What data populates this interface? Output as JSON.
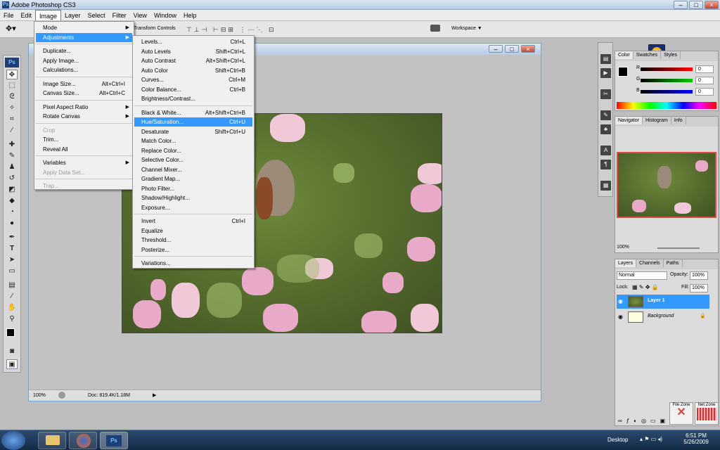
{
  "app": {
    "title": "Adobe Photoshop CS3",
    "logo": "Ps"
  },
  "menubar": [
    "File",
    "Edit",
    "Image",
    "Layer",
    "Select",
    "Filter",
    "View",
    "Window",
    "Help"
  ],
  "options": {
    "transform_controls": "Transform Controls",
    "workspace": "Workspace ▼"
  },
  "image_menu": [
    {
      "label": "Mode",
      "shortcut": "",
      "arrow": "▶"
    },
    {
      "label": "Adjustments",
      "shortcut": "",
      "arrow": "▶",
      "hl": true
    },
    {
      "label": "Duplicate...",
      "shortcut": ""
    },
    {
      "label": "Apply Image...",
      "shortcut": ""
    },
    {
      "label": "Calculations...",
      "shortcut": ""
    },
    {
      "label": "Image Size...",
      "shortcut": "Alt+Ctrl+I"
    },
    {
      "label": "Canvas Size...",
      "shortcut": "Alt+Ctrl+C"
    },
    {
      "label": "Pixel Aspect Ratio",
      "shortcut": "",
      "arrow": "▶"
    },
    {
      "label": "Rotate Canvas",
      "shortcut": "",
      "arrow": "▶"
    },
    {
      "label": "Crop",
      "shortcut": "",
      "dis": true
    },
    {
      "label": "Trim...",
      "shortcut": ""
    },
    {
      "label": "Reveal All",
      "shortcut": ""
    },
    {
      "label": "Variables",
      "shortcut": "",
      "arrow": "▶"
    },
    {
      "label": "Apply Data Set...",
      "shortcut": "",
      "dis": true
    },
    {
      "label": "Trap...",
      "shortcut": "",
      "dis": true
    }
  ],
  "adjust_menu": [
    {
      "label": "Levels...",
      "shortcut": "Ctrl+L"
    },
    {
      "label": "Auto Levels",
      "shortcut": "Shift+Ctrl+L"
    },
    {
      "label": "Auto Contrast",
      "shortcut": "Alt+Shift+Ctrl+L"
    },
    {
      "label": "Auto Color",
      "shortcut": "Shift+Ctrl+B"
    },
    {
      "label": "Curves...",
      "shortcut": "Ctrl+M"
    },
    {
      "label": "Color Balance...",
      "shortcut": "Ctrl+B"
    },
    {
      "label": "Brightness/Contrast...",
      "shortcut": ""
    },
    {
      "label": "Black & White...",
      "shortcut": "Alt+Shift+Ctrl+B"
    },
    {
      "label": "Hue/Saturation...",
      "shortcut": "Ctrl+U",
      "hl": true
    },
    {
      "label": "Desaturate",
      "shortcut": "Shift+Ctrl+U"
    },
    {
      "label": "Match Color...",
      "shortcut": ""
    },
    {
      "label": "Replace Color...",
      "shortcut": ""
    },
    {
      "label": "Selective Color...",
      "shortcut": ""
    },
    {
      "label": "Channel Mixer...",
      "shortcut": ""
    },
    {
      "label": "Gradient Map...",
      "shortcut": ""
    },
    {
      "label": "Photo Filter...",
      "shortcut": ""
    },
    {
      "label": "Shadow/Highlight...",
      "shortcut": ""
    },
    {
      "label": "Exposure...",
      "shortcut": ""
    },
    {
      "label": "Invert",
      "shortcut": "Ctrl+I"
    },
    {
      "label": "Equalize",
      "shortcut": ""
    },
    {
      "label": "Threshold...",
      "shortcut": ""
    },
    {
      "label": "Posterize...",
      "shortcut": ""
    },
    {
      "label": "Variations...",
      "shortcut": ""
    }
  ],
  "status": {
    "zoom": "100%",
    "doc": "Doc: 819.4K/1.18M"
  },
  "color_panel": {
    "tabs": [
      "Color",
      "Swatches",
      "Styles"
    ],
    "channels": [
      {
        "name": "R",
        "value": "0"
      },
      {
        "name": "G",
        "value": "0"
      },
      {
        "name": "B",
        "value": "0"
      }
    ]
  },
  "navigator": {
    "tabs": [
      "Navigator",
      "Histogram",
      "Info"
    ],
    "zoom": "100%"
  },
  "layers": {
    "tabs": [
      "Layers",
      "Channels",
      "Paths"
    ],
    "blend": "Normal",
    "opacity_label": "Opacity:",
    "opacity": "100%",
    "lock_label": "Lock:",
    "fill_label": "Fill:",
    "fill": "100%",
    "rows": [
      {
        "name": "Layer 1",
        "selected": true
      },
      {
        "name": "Background",
        "selected": false
      }
    ]
  },
  "zones": {
    "file": "File Zone",
    "net": "Net Zone"
  },
  "taskbar": {
    "desktop": "Desktop",
    "time": "6:51 PM",
    "date": "5/26/2009"
  },
  "colors": {
    "highlight": "#3399ff",
    "taskbar": "#1c3554"
  }
}
